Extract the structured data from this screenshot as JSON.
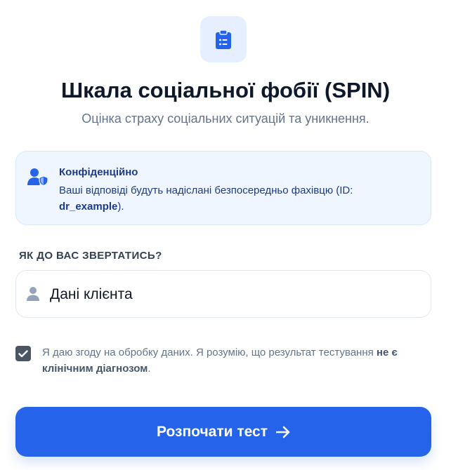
{
  "header": {
    "icon": "clipboard-list-icon",
    "title": "Шкала соціальної фобії (SPIN)",
    "subtitle": "Оцінка страху соціальних ситуацій та уникнення."
  },
  "privacy_notice": {
    "icon": "user-shield-icon",
    "title": "Конфіденційно",
    "text_before": "Ваші відповіді будуть надіслані безпосередньо фахівцю (ID: ",
    "specialist_id": "dr_example",
    "text_after": ")."
  },
  "name_field": {
    "label": "ЯК ДО ВАС ЗВЕРТАТИСЬ?",
    "icon": "user-icon",
    "value": "Дані клієнта"
  },
  "consent": {
    "checked": true,
    "text": "Я даю згоду на обробку даних. Я розумію, що результат тестування ",
    "bold": "не є клінічним діагнозом",
    "end": "."
  },
  "start_button": {
    "label": "Розпочати тест",
    "icon": "arrow-right-icon"
  },
  "colors": {
    "primary": "#2563eb",
    "notice_bg": "#eff6ff",
    "notice_text": "#1e3a8a",
    "icon_bg": "#e5efff"
  }
}
